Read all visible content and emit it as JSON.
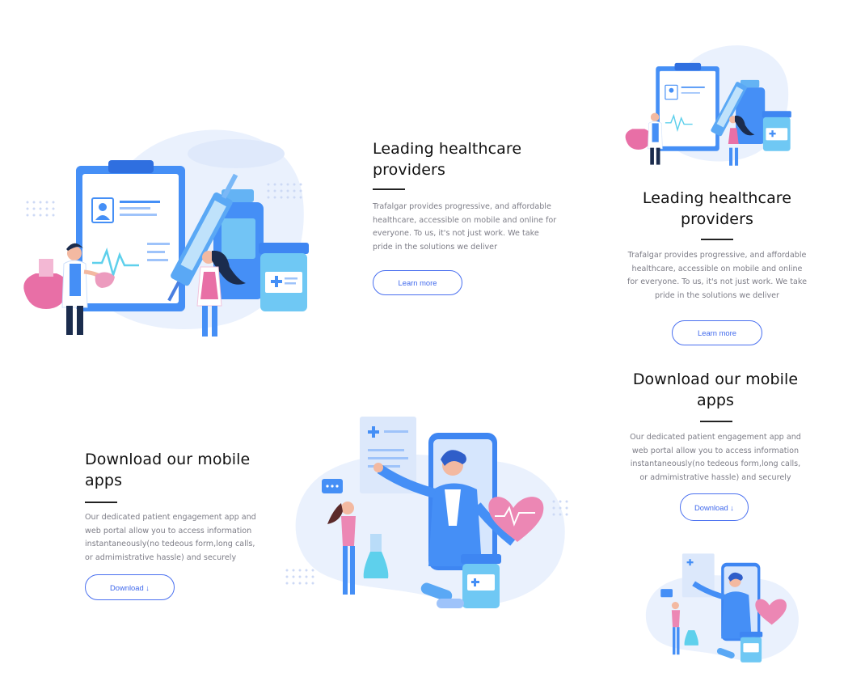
{
  "section_healthcare": {
    "title": "Leading healthcare providers",
    "description": "Trafalgar provides progressive, and affordable healthcare, accessible on mobile and online for everyone. To us, it's not just work. We take pride in the solutions we deliver",
    "button_label": "Learn more"
  },
  "section_apps": {
    "title": "Download our mobile apps",
    "description": "Our dedicated patient engagement app and web portal allow you to access information instantaneously(no tedeous form,long calls, or admimistrative hassle) and securely",
    "button_label": "Download ↓"
  },
  "colors": {
    "accent": "#4a70f0",
    "primary_blue": "#458ff6",
    "pink": "#e86fa6",
    "light_blob": "#eaf1fd"
  },
  "illustrations": {
    "healthcare": "doctors-clipboard-illustration",
    "apps": "doctor-phone-heart-illustration"
  }
}
